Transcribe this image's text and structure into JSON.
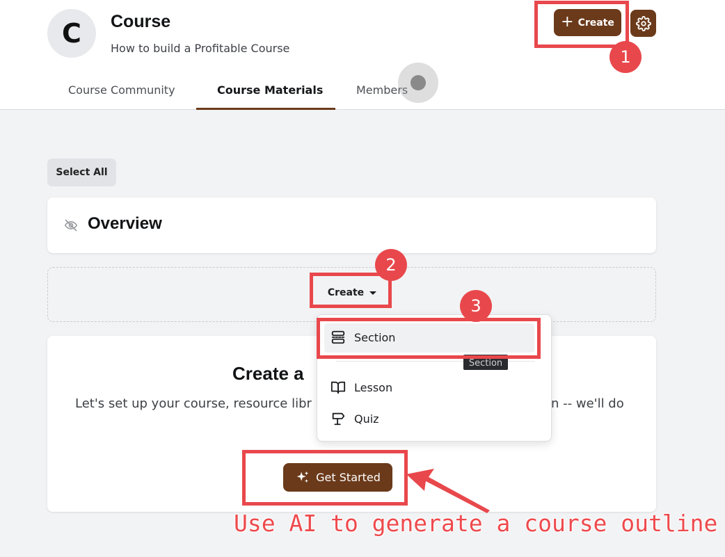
{
  "header": {
    "avatar_letter": "C",
    "title": "Course",
    "subtitle": "How to build a Profitable Course",
    "create_label": "Create",
    "tabs": [
      {
        "label": "Course Community"
      },
      {
        "label": "Course Materials"
      },
      {
        "label": "Members"
      }
    ]
  },
  "main": {
    "select_all_label": "Select All",
    "overview_title": "Overview",
    "create_dropdown_label": "Create",
    "create_card": {
      "heading": "Create a",
      "description_left": "Let's set up your course, resource libr",
      "description_right": "n -- we'll do",
      "get_started_label": "Get Started"
    }
  },
  "menu": {
    "items": [
      {
        "label": "Section",
        "icon": "section-icon"
      },
      {
        "label": "Lesson",
        "icon": "book-icon"
      },
      {
        "label": "Quiz",
        "icon": "signpost-icon"
      }
    ],
    "tooltip": "Section"
  },
  "annotations": {
    "badges": [
      "1",
      "2",
      "3"
    ],
    "caption": "Use AI to generate a course outline",
    "color": "#e8484c"
  },
  "colors": {
    "brand": "#6b3a1a",
    "annotation": "#e8484c"
  }
}
